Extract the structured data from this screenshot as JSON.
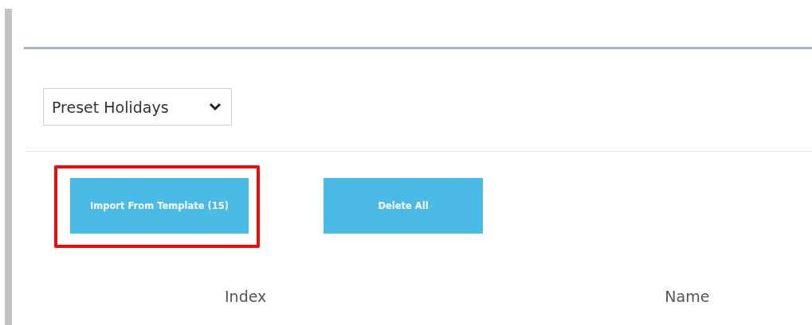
{
  "preset_select": {
    "value": "Preset Holidays"
  },
  "buttons": [
    {
      "label": "Import From Template (15)",
      "highlighted": true
    },
    {
      "label": "Delete All",
      "highlighted": false
    }
  ],
  "table": {
    "columns": [
      "Index",
      "Name"
    ]
  }
}
